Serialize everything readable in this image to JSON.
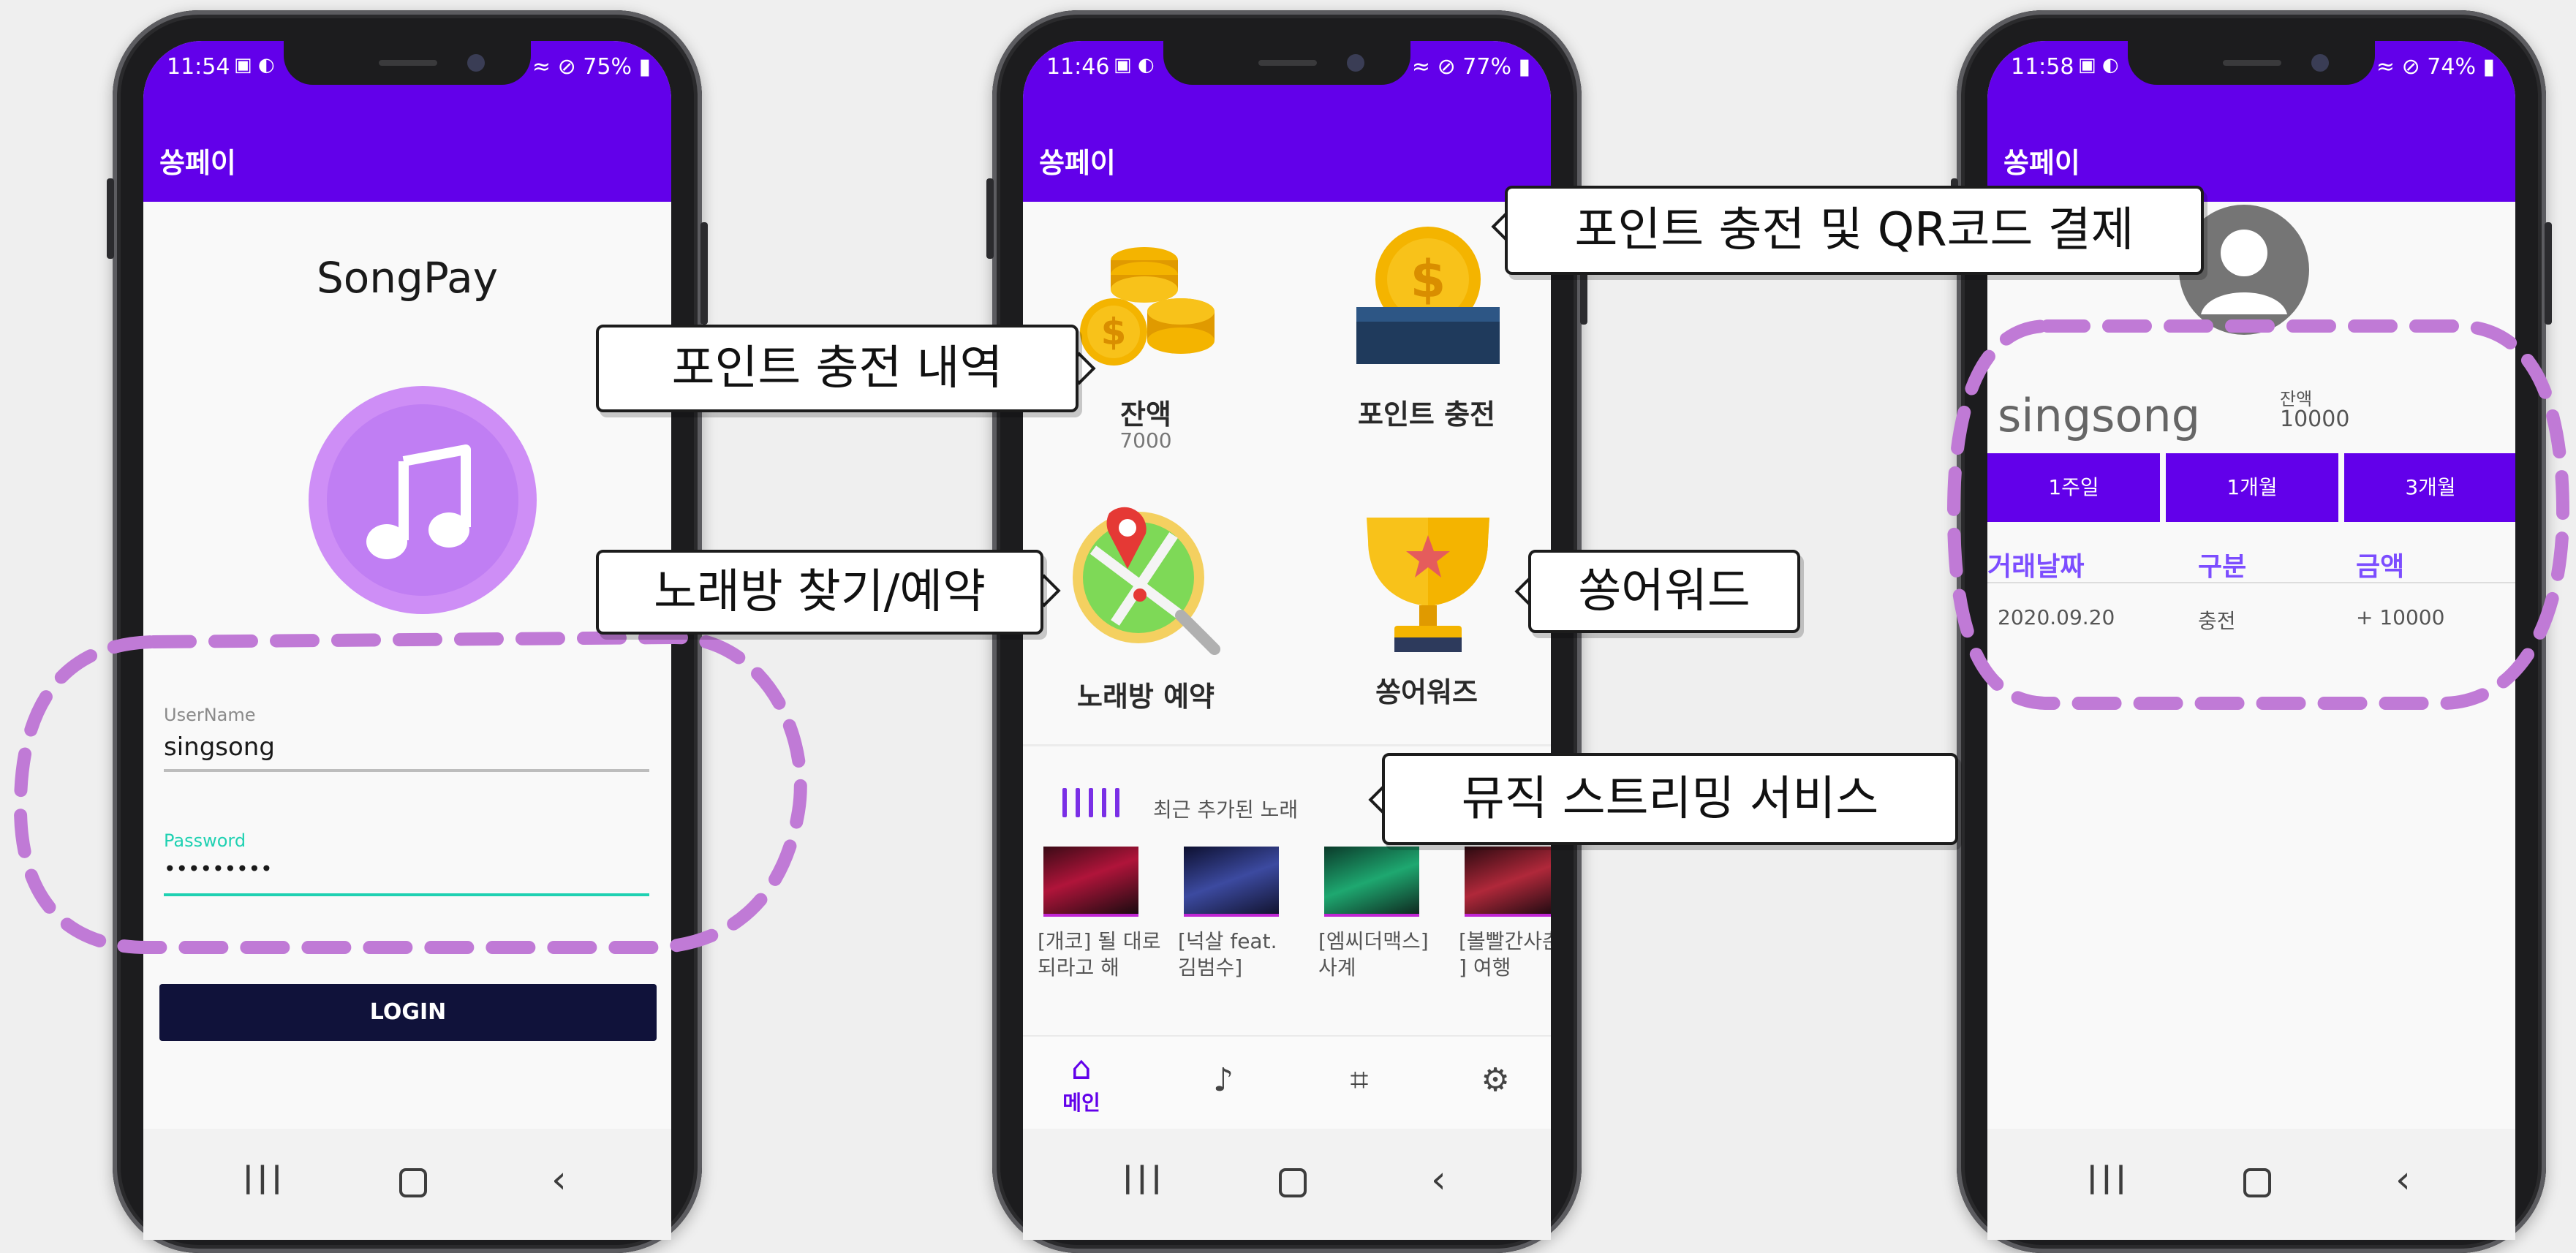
{
  "phones": {
    "login": {
      "status": {
        "time": "11:54",
        "battery": "75%"
      },
      "appbar_title": "쏭페이",
      "app_name": "SongPay",
      "username": {
        "label": "UserName",
        "value": "singsong"
      },
      "password": {
        "label": "Password",
        "value": "•••••••••"
      },
      "login_button": "LOGIN"
    },
    "main": {
      "status": {
        "time": "11:46",
        "battery": "77%"
      },
      "appbar_title": "쏭페이",
      "tiles": {
        "balance": {
          "label": "잔액",
          "value": "7000"
        },
        "charge": {
          "label": "포인트 충전"
        },
        "karaoke": {
          "label": "노래방 예약"
        },
        "awards": {
          "label": "쏭어워즈"
        }
      },
      "recent_label": "최근 추가된 노래",
      "songs": [
        {
          "title": "[개코] 될 대로\n되라고 해"
        },
        {
          "title": "[넉살 feat.\n김범수]"
        },
        {
          "title": "[엠씨더맥스]\n사계"
        },
        {
          "title": "[볼빨간사춘\n] 여행"
        }
      ],
      "bottom_nav": {
        "home_label": "메인"
      }
    },
    "profile": {
      "status": {
        "time": "11:58",
        "battery": "74%"
      },
      "appbar_title": "쏭페이",
      "username": "singsong",
      "balance_label": "잔액",
      "balance_value": "10000",
      "tabs": [
        "1주일",
        "1개월",
        "3개월"
      ],
      "table_headers": [
        "거래날짜",
        "구분",
        "금액"
      ],
      "rows": [
        {
          "date": "2020.09.20",
          "type": "충전",
          "amount": "+ 10000"
        }
      ]
    }
  },
  "callouts": {
    "charge_history": "포인트 충전 내역",
    "karaoke_search": "노래방 찾기/예약",
    "charge_qr": "포인트 충전 및 QR코드 결제",
    "songward": "쏭어워드",
    "streaming": "뮤직 스트리밍 서비스"
  },
  "colors": {
    "primary": "#6200ea",
    "login_button": "#10123a",
    "accent_teal": "#1fd1b2",
    "dashed_outline": "#c07ad6"
  }
}
